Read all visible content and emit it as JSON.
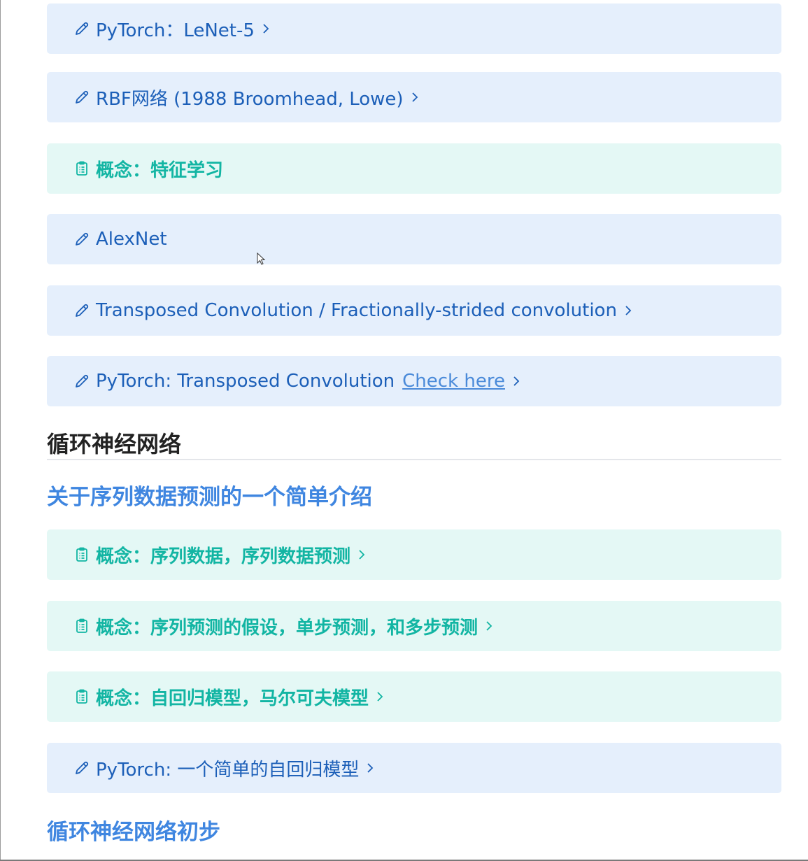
{
  "items_top": [
    {
      "type": "code",
      "icon": "pencil-icon",
      "label": "PyTorch：LeNet-5",
      "has_chevron": true
    },
    {
      "type": "code",
      "icon": "pencil-icon",
      "label": "RBF网络 (1988 Broomhead, Lowe)",
      "has_chevron": true
    },
    {
      "type": "concept",
      "icon": "clipboard-icon",
      "label": "概念：特征学习",
      "has_chevron": false
    },
    {
      "type": "code",
      "icon": "pencil-icon",
      "label": "AlexNet",
      "has_chevron": false
    },
    {
      "type": "code",
      "icon": "pencil-icon",
      "label": "Transposed Convolution / Fractionally-strided convolution",
      "has_chevron": true
    },
    {
      "type": "code",
      "icon": "pencil-icon",
      "label": "PyTorch: Transposed Convolution",
      "link": "Check here",
      "has_chevron": true
    }
  ],
  "section": {
    "title": "循环神经网络"
  },
  "subsection1": {
    "title": "关于序列数据预测的一个简单介绍"
  },
  "items_bottom": [
    {
      "type": "concept",
      "icon": "clipboard-icon",
      "label": "概念：序列数据，序列数据预测",
      "has_chevron": true
    },
    {
      "type": "concept",
      "icon": "clipboard-icon",
      "label": "概念：序列预测的假设，单步预测，和多步预测",
      "has_chevron": true
    },
    {
      "type": "concept",
      "icon": "clipboard-icon",
      "label": "概念：自回归模型，马尔可夫模型",
      "has_chevron": true
    },
    {
      "type": "code",
      "icon": "pencil-icon",
      "label": "PyTorch: 一个简单的自回归模型",
      "has_chevron": true
    }
  ],
  "subsection2": {
    "title": "循环神经网络初步"
  },
  "colors": {
    "code_bg": "#e5effc",
    "code_text": "#1c5fb8",
    "concept_bg": "#e4f8f5",
    "concept_text": "#12b5a3",
    "subsection_text": "#3f86e0",
    "link": "#4a8ad9"
  }
}
